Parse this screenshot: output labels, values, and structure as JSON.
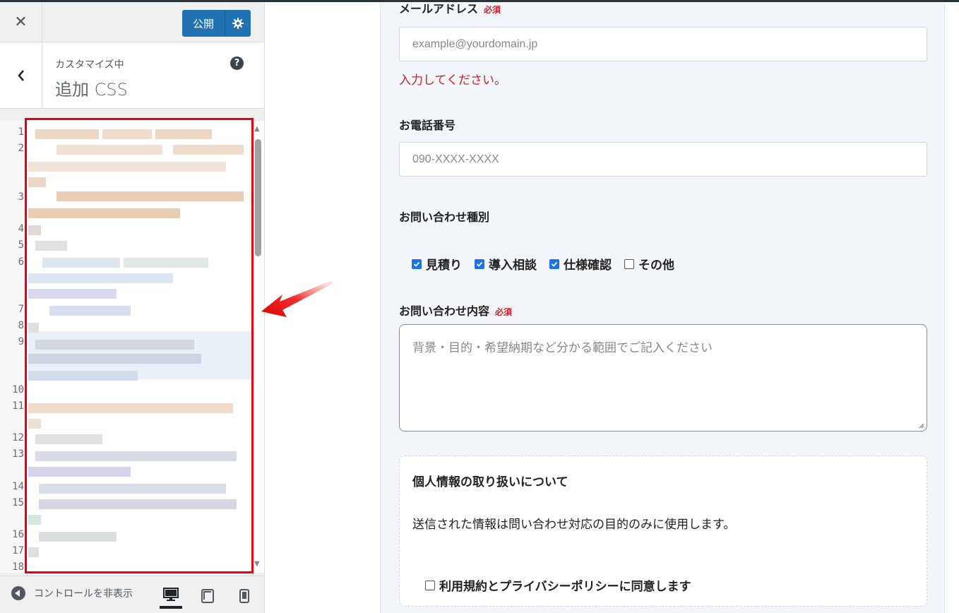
{
  "sidebar": {
    "close_label": "✕",
    "publish_label": "公開",
    "section_subtitle": "カスタマイズ中",
    "section_title": "追加 CSS",
    "help_label": "?",
    "line_numbers": [
      "1",
      "2",
      "3",
      "4",
      "5",
      "6",
      "7",
      "8",
      "9",
      "10",
      "11",
      "12",
      "13",
      "14",
      "15",
      "16",
      "17",
      "18"
    ],
    "footer": {
      "collapse_label": "コントロールを非表示"
    }
  },
  "form": {
    "email_label": "メールアドレス",
    "email_required": "必須",
    "email_placeholder": "example@yourdomain.jp",
    "email_error": "入力してください。",
    "phone_label": "お電話番号",
    "phone_placeholder": "090-XXXX-XXXX",
    "inquiry_type_label": "お問い合わせ種別",
    "inquiry_types": [
      {
        "label": "見積り",
        "checked": true
      },
      {
        "label": "導入相談",
        "checked": true
      },
      {
        "label": "仕様確認",
        "checked": true
      },
      {
        "label": "その他",
        "checked": false
      }
    ],
    "content_label": "お問い合わせ内容",
    "content_required": "必須",
    "content_placeholder": "背景・目的・希望納期など分かる範囲でご記入ください",
    "privacy_title": "個人情報の取り扱いについて",
    "privacy_text": "送信された情報は問い合わせ対応の目的のみに使用します。",
    "agree_label": "利用規約とプライバシーポリシーに同意します"
  }
}
